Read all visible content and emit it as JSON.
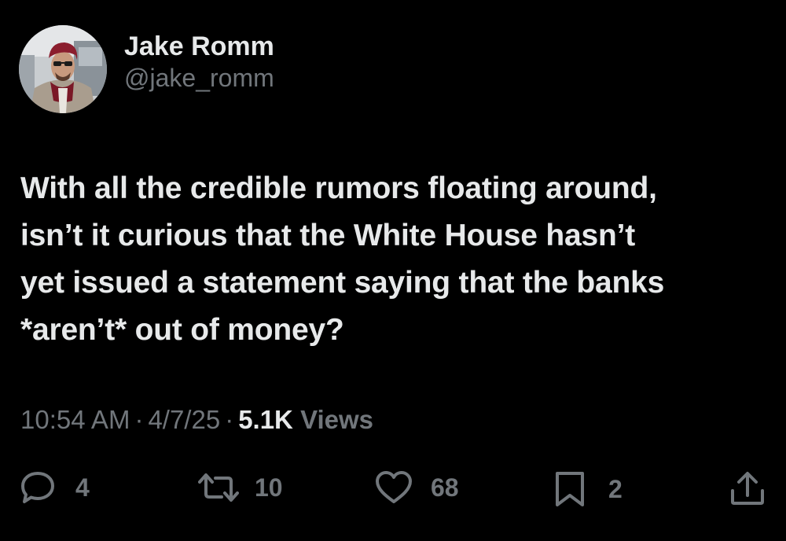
{
  "author": {
    "display_name": "Jake Romm",
    "handle": "@jake_romm"
  },
  "tweet": {
    "text": "With all the credible rumors floating around,\nisn’t it curious that the White House hasn’t\nyet issued a statement saying that the banks\n*aren’t* out of money?",
    "time": "10:54 AM",
    "date": "4/7/25",
    "separator": "·",
    "views_count": "5.1K",
    "views_label": "Views"
  },
  "actions": {
    "replies": "4",
    "reposts": "10",
    "likes": "68",
    "bookmarks": "2"
  },
  "icons": {
    "reply": "reply-icon",
    "repost": "repost-icon",
    "like": "heart-icon",
    "bookmark": "bookmark-icon",
    "share": "share-icon"
  },
  "colors": {
    "background": "#000000",
    "primary_text": "#e7e9ea",
    "secondary_text": "#71767b"
  }
}
